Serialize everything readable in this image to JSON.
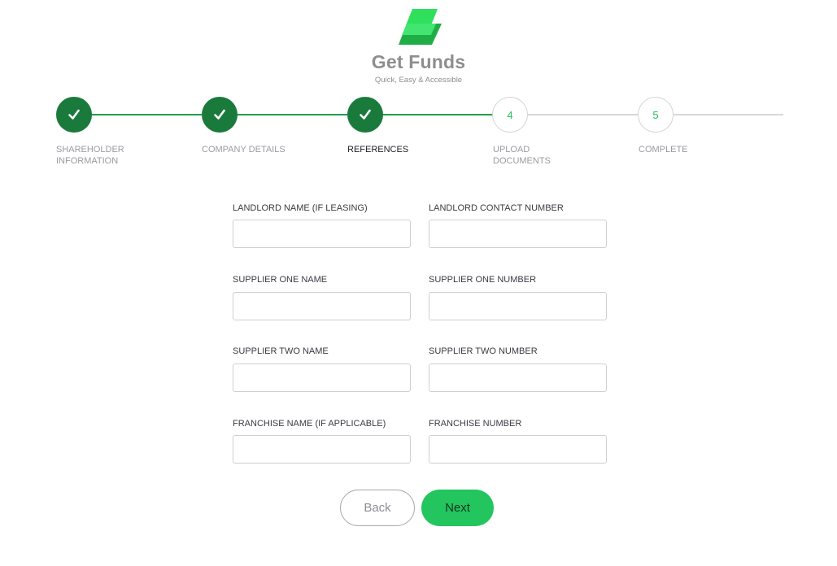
{
  "brand": {
    "name": "Get Funds",
    "tagline": "Quick, Easy & Accessible",
    "colors": {
      "primary_green": "#22c55e",
      "dark_green": "#1a7a3c",
      "logo_green_light": "#3ee86a",
      "logo_green_dark": "#1fae45",
      "text_gray": "#8e8e8e"
    }
  },
  "stepper": {
    "steps": [
      {
        "number": "1",
        "label": "SHAREHOLDER INFORMATION",
        "status": "completed",
        "icon": "check-icon"
      },
      {
        "number": "2",
        "label": "COMPANY DETAILS",
        "status": "completed",
        "icon": "check-icon"
      },
      {
        "number": "3",
        "label": "REFERENCES",
        "status": "completed",
        "icon": "check-icon",
        "current": true
      },
      {
        "number": "4",
        "label": "UPLOAD DOCUMENTS",
        "status": "pending"
      },
      {
        "number": "5",
        "label": "COMPLETE",
        "status": "pending"
      }
    ]
  },
  "form": {
    "fields": [
      {
        "label": "LANDLORD NAME (IF LEASING)",
        "value": "",
        "placeholder": ""
      },
      {
        "label": "LANDLORD CONTACT NUMBER",
        "value": "",
        "placeholder": ""
      },
      {
        "label": "SUPPLIER ONE NAME",
        "value": "",
        "placeholder": ""
      },
      {
        "label": "SUPPLIER ONE NUMBER",
        "value": "",
        "placeholder": ""
      },
      {
        "label": "SUPPLIER TWO NAME",
        "value": "",
        "placeholder": ""
      },
      {
        "label": "SUPPLIER TWO NUMBER",
        "value": "",
        "placeholder": ""
      },
      {
        "label": "FRANCHISE NAME (IF APPLICABLE)",
        "value": "",
        "placeholder": ""
      },
      {
        "label": "FRANCHISE NUMBER",
        "value": "",
        "placeholder": ""
      }
    ]
  },
  "actions": {
    "back_label": "Back",
    "next_label": "Next"
  }
}
